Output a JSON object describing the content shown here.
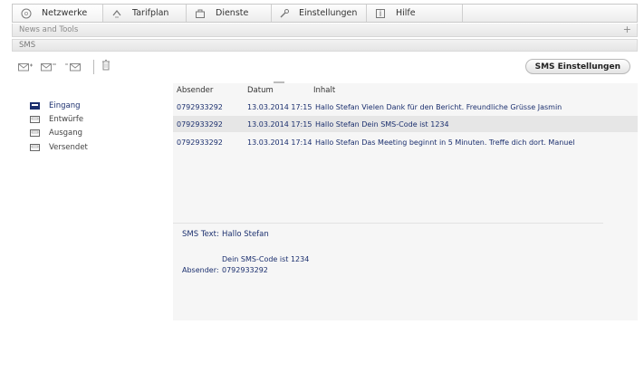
{
  "tabs": [
    {
      "label": "Netzwerke",
      "icon": "globe-icon"
    },
    {
      "label": "Tarifplan",
      "icon": "arrows-icon"
    },
    {
      "label": "Dienste",
      "icon": "briefcase-icon"
    },
    {
      "label": "Einstellungen",
      "icon": "wrench-icon"
    },
    {
      "label": "Hilfe",
      "icon": "info-icon"
    }
  ],
  "news": {
    "label": "News and Tools",
    "toggle": "+"
  },
  "section": {
    "title": "SMS"
  },
  "toolbar": {
    "settings_label": "SMS Einstellungen"
  },
  "folders": [
    {
      "label": "Eingang",
      "active": true
    },
    {
      "label": "Entwürfe",
      "active": false
    },
    {
      "label": "Ausgang",
      "active": false
    },
    {
      "label": "Versendet",
      "active": false
    }
  ],
  "table": {
    "headers": {
      "sender": "Absender",
      "date": "Datum",
      "content": "Inhalt"
    },
    "rows": [
      {
        "sender": "0792933292",
        "date": "13.03.2014 17:15",
        "content": "Hallo Stefan  Vielen Dank für den Bericht.  Freundliche Grüsse Jasmin"
      },
      {
        "sender": "0792933292",
        "date": "13.03.2014 17:15",
        "content": "Hallo Stefan   Dein SMS-Code ist 1234"
      },
      {
        "sender": "0792933292",
        "date": "13.03.2014 17:14",
        "content": "Hallo Stefan Das Meeting beginnt in 5 Minuten.  Treffe dich dort. Manuel"
      }
    ]
  },
  "detail": {
    "text_label": "SMS Text:",
    "text_line1": "Hallo Stefan",
    "text_line2": "Dein SMS-Code ist 1234",
    "sender_label": "Absender:",
    "sender_value": "0792933292"
  },
  "colors": {
    "link": "#1b2f6e",
    "selected_row": "#e6e6e6",
    "panel": "#f6f6f6"
  }
}
